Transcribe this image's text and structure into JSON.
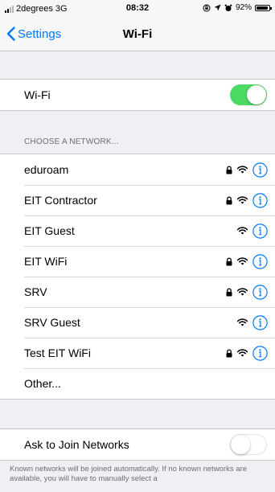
{
  "status_bar": {
    "carrier": "2degrees",
    "network": "3G",
    "time": "08:32",
    "battery": "92%",
    "battery_level": 0.92
  },
  "nav": {
    "back_label": "Settings",
    "title": "Wi-Fi"
  },
  "wifi_toggle": {
    "label": "Wi-Fi",
    "on": true
  },
  "networks_header": "CHOOSE A NETWORK...",
  "networks": [
    {
      "name": "eduroam",
      "locked": true
    },
    {
      "name": "EIT Contractor",
      "locked": true
    },
    {
      "name": "EIT Guest",
      "locked": false
    },
    {
      "name": "EIT WiFi",
      "locked": true
    },
    {
      "name": "SRV",
      "locked": true
    },
    {
      "name": "SRV Guest",
      "locked": false
    },
    {
      "name": "Test EIT WiFi",
      "locked": true
    }
  ],
  "other_label": "Other...",
  "ask_to_join": {
    "label": "Ask to Join Networks",
    "on": false
  },
  "footer_text": "Known networks will be joined automatically. If no known networks are available, you will have to manually select a",
  "colors": {
    "accent": "#007aff",
    "toggle_on": "#4cd964",
    "background": "#efeff4"
  }
}
